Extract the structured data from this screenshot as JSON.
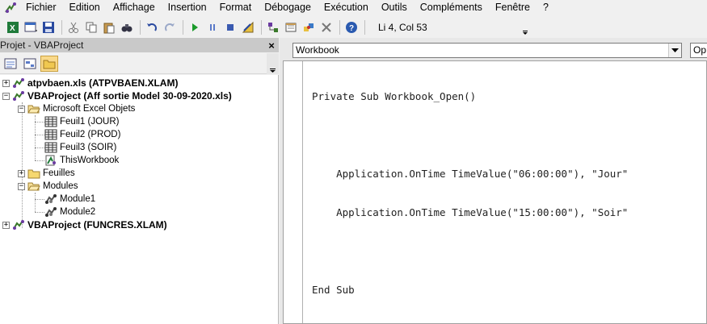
{
  "menu": {
    "items": [
      {
        "label": "Fichier"
      },
      {
        "label": "Edition"
      },
      {
        "label": "Affichage"
      },
      {
        "label": "Insertion"
      },
      {
        "label": "Format"
      },
      {
        "label": "Débogage"
      },
      {
        "label": "Exécution"
      },
      {
        "label": "Outils"
      },
      {
        "label": "Compléments"
      },
      {
        "label": "Fenêtre"
      },
      {
        "label": "?"
      }
    ]
  },
  "toolbar": {
    "position_text": "Li 4, Col 53",
    "icons": [
      "excel-icon",
      "insert-userform-icon",
      "save-icon",
      "cut-icon",
      "copy-icon",
      "paste-icon",
      "find-icon",
      "undo-icon",
      "redo-icon",
      "run-icon",
      "break-icon",
      "reset-icon",
      "design-mode-icon",
      "project-explorer-icon",
      "properties-icon",
      "object-browser-icon",
      "toolbox-icon",
      "help-icon"
    ]
  },
  "project": {
    "title": "Projet - VBAProject",
    "close_label": "×",
    "tree": [
      {
        "label": "atpvbaen.xls (ATPVBAEN.XLAM)"
      },
      {
        "label": "VBAProject (Aff sortie Model 30-09-2020.xls)"
      },
      {
        "label": "Microsoft Excel Objets"
      },
      {
        "label": "Feuil1 (JOUR)"
      },
      {
        "label": "Feuil2 (PROD)"
      },
      {
        "label": "Feuil3 (SOIR)"
      },
      {
        "label": "ThisWorkbook"
      },
      {
        "label": "Feuilles"
      },
      {
        "label": "Modules"
      },
      {
        "label": "Module1"
      },
      {
        "label": "Module2"
      },
      {
        "label": "VBAProject (FUNCRES.XLAM)"
      }
    ]
  },
  "code_window": {
    "object_combo": "Workbook",
    "procedure_combo": "Op",
    "lines": [
      "Private Sub Workbook_Open()",
      "",
      "    Application.OnTime TimeValue(\"06:00:00\"), \"Jour\"",
      "    Application.OnTime TimeValue(\"15:00:00\"), \"Soir\"",
      "",
      "End Sub"
    ]
  },
  "colors": {
    "keyword": "#00007f",
    "panel_title": "#c9c9c9",
    "active_button": "#f9d98a"
  }
}
